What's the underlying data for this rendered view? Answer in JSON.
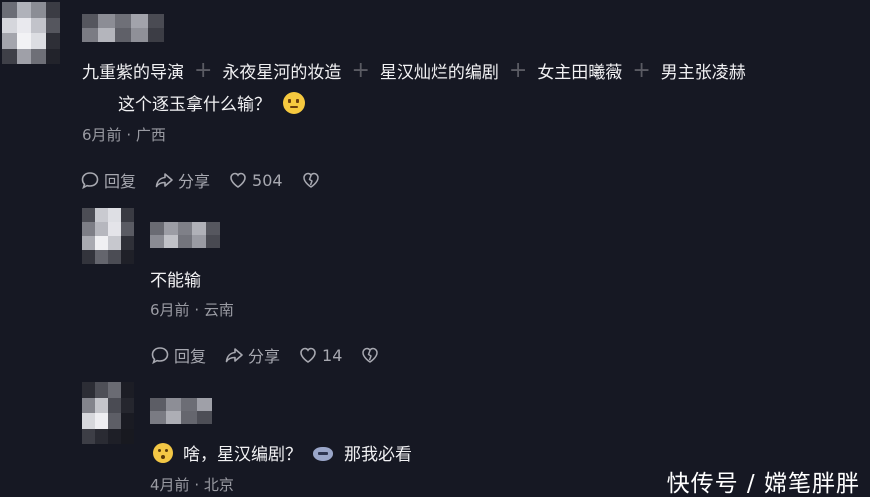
{
  "comment1": {
    "segments": [
      "九重紫的导演",
      "永夜星河的妆造",
      "星汉灿烂的编剧",
      "女主田曦薇",
      "男主张凌赫"
    ],
    "separator": "+",
    "line2": "这个逐玉拿什么输？",
    "emoji": "thinking-face-emoji",
    "time": "6月前",
    "location": "广西",
    "reply_label": "回复",
    "share_label": "分享",
    "likes": "504"
  },
  "reply1": {
    "text": "不能输",
    "time": "6月前",
    "location": "云南",
    "reply_label": "回复",
    "share_label": "分享",
    "likes": "14"
  },
  "reply2": {
    "text_part1": "啥，星汉编剧？",
    "text_part2": "那我必看",
    "emoji1": "surprised-face-emoji",
    "emoji2": "cat-face-emoji",
    "time": "4月前",
    "location": "北京"
  },
  "meta_separator": "·",
  "watermark": "快传号 / 嫦笔胖胖",
  "colors": {
    "background": "#161823",
    "primary_text": "#f1f1f3",
    "secondary_text": "#9a9ba3",
    "action_text": "#a7a8b0"
  }
}
